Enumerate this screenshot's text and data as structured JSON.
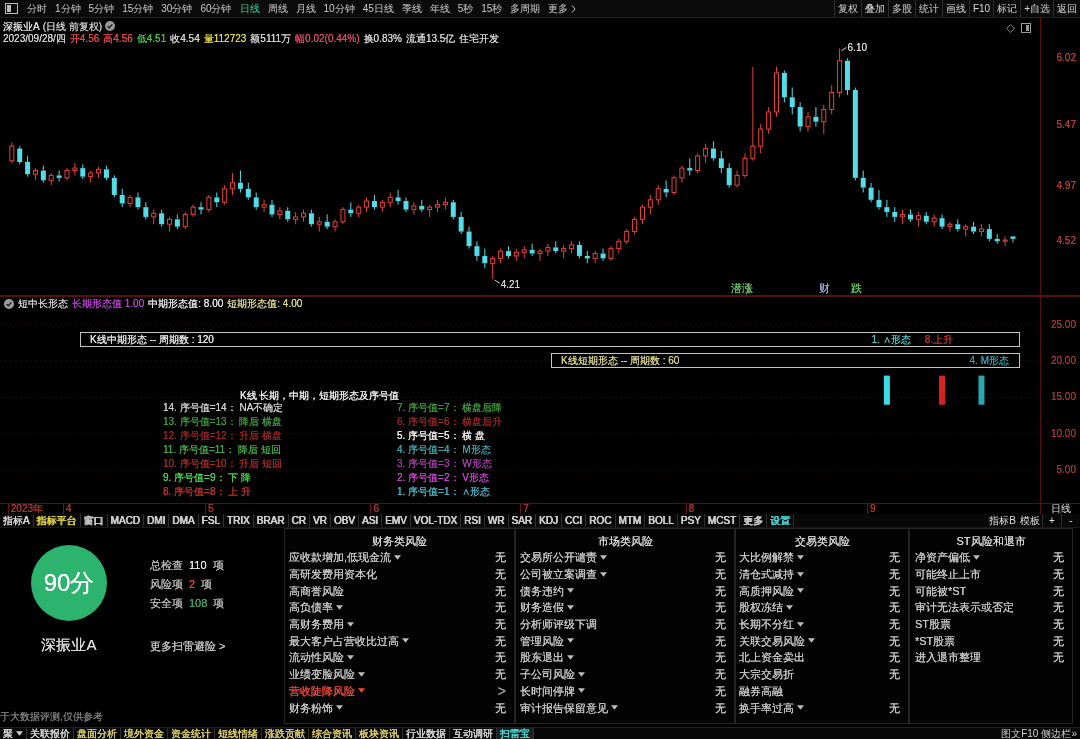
{
  "toolbar": {
    "periods": [
      {
        "label": "分时",
        "selected": false
      },
      {
        "label": "1分钟",
        "selected": false
      },
      {
        "label": "5分钟",
        "selected": false
      },
      {
        "label": "15分钟",
        "selected": false
      },
      {
        "label": "30分钟",
        "selected": false
      },
      {
        "label": "60分钟",
        "selected": false
      },
      {
        "label": "日线",
        "selected": true
      },
      {
        "label": "周线",
        "selected": false
      },
      {
        "label": "月线",
        "selected": false
      },
      {
        "label": "10分钟",
        "selected": false
      },
      {
        "label": "45日线",
        "selected": false
      },
      {
        "label": "季线",
        "selected": false
      },
      {
        "label": "年线",
        "selected": false
      },
      {
        "label": "5秒",
        "selected": false
      },
      {
        "label": "15秒",
        "selected": false
      },
      {
        "label": "多周期",
        "selected": false
      }
    ],
    "more": "更多",
    "actions": [
      "复权",
      "叠加",
      "多股",
      "统计",
      "画线",
      "F10",
      "标记",
      "+自选",
      "返回"
    ]
  },
  "quote": {
    "stock": "深振业A",
    "mode": "(日线 前复权)",
    "date": "2023/09/28/四",
    "fields": [
      {
        "text": "开4.56",
        "color": "#e84848"
      },
      {
        "text": "高4.56",
        "color": "#e84848"
      },
      {
        "text": "低4.51",
        "color": "#3cc83c"
      },
      {
        "text": "收4.54",
        "color": "#d4d4d4"
      },
      {
        "text": "量112723",
        "color": "#e6d64a"
      },
      {
        "text": "额5111万",
        "color": "#d4d4d4"
      },
      {
        "text": "幅0.02(0.44%)",
        "color": "#d84a6a"
      },
      {
        "text": "换0.83%",
        "color": "#d4d4d4"
      },
      {
        "text": "流通13.5亿",
        "color": "#d4d4d4"
      },
      {
        "text": "住宅开发",
        "color": "#d4d4d4"
      }
    ]
  },
  "chart": {
    "chart_data": [
      {
        "type": "candlestick",
        "ylim": [
          4.08,
          6.35
        ],
        "yticks": [
          4.52,
          4.97,
          5.47,
          6.02
        ],
        "annotations": [
          "6.10",
          "4.21",
          "潜涨",
          "财",
          "跌"
        ],
        "ohlc": [
          null,
          [
            5.18,
            5.33,
            5.16,
            5.3
          ],
          [
            5.28,
            5.3,
            5.15,
            5.17
          ],
          [
            5.17,
            5.22,
            5.05,
            5.07
          ],
          [
            5.07,
            5.12,
            5.02,
            5.1
          ],
          [
            5.1,
            5.14,
            5.0,
            5.02
          ],
          [
            5.02,
            5.08,
            4.98,
            5.06
          ],
          [
            5.06,
            5.1,
            5.01,
            5.04
          ],
          [
            5.04,
            5.12,
            5.02,
            5.1
          ],
          [
            5.1,
            5.16,
            5.06,
            5.12
          ],
          [
            5.12,
            5.15,
            5.03,
            5.05
          ],
          [
            5.05,
            5.1,
            5.0,
            5.08
          ],
          [
            5.08,
            5.13,
            5.04,
            5.11
          ],
          [
            5.11,
            5.14,
            5.02,
            5.04
          ],
          [
            5.04,
            5.06,
            4.88,
            4.9
          ],
          [
            4.9,
            4.95,
            4.8,
            4.83
          ],
          [
            4.83,
            4.9,
            4.8,
            4.88
          ],
          [
            4.88,
            4.92,
            4.78,
            4.8
          ],
          [
            4.8,
            4.84,
            4.7,
            4.72
          ],
          [
            4.72,
            4.78,
            4.66,
            4.75
          ],
          [
            4.75,
            4.78,
            4.64,
            4.66
          ],
          [
            4.66,
            4.72,
            4.6,
            4.7
          ],
          [
            4.7,
            4.74,
            4.62,
            4.64
          ],
          [
            4.64,
            4.76,
            4.62,
            4.74
          ],
          [
            4.74,
            4.82,
            4.72,
            4.8
          ],
          [
            4.8,
            4.84,
            4.74,
            4.78
          ],
          [
            4.78,
            4.9,
            4.76,
            4.88
          ],
          [
            4.88,
            4.92,
            4.8,
            4.84
          ],
          [
            4.84,
            4.98,
            4.82,
            4.95
          ],
          [
            4.95,
            5.08,
            4.9,
            5.0
          ],
          [
            5.0,
            5.1,
            4.92,
            4.95
          ],
          [
            4.95,
            5.0,
            4.86,
            4.88
          ],
          [
            4.88,
            4.92,
            4.78,
            4.8
          ],
          [
            4.8,
            4.86,
            4.76,
            4.82
          ],
          [
            4.82,
            4.86,
            4.72,
            4.74
          ],
          [
            4.74,
            4.8,
            4.7,
            4.77
          ],
          [
            4.77,
            4.8,
            4.68,
            4.7
          ],
          [
            4.7,
            4.76,
            4.66,
            4.72
          ],
          [
            4.72,
            4.78,
            4.68,
            4.75
          ],
          [
            4.75,
            4.78,
            4.64,
            4.66
          ],
          [
            4.66,
            4.72,
            4.6,
            4.68
          ],
          [
            4.68,
            4.74,
            4.62,
            4.64
          ],
          [
            4.64,
            4.7,
            4.6,
            4.68
          ],
          [
            4.68,
            4.8,
            4.66,
            4.78
          ],
          [
            4.78,
            4.84,
            4.72,
            4.75
          ],
          [
            4.75,
            4.82,
            4.72,
            4.8
          ],
          [
            4.8,
            4.88,
            4.76,
            4.85
          ],
          [
            4.85,
            4.9,
            4.78,
            4.8
          ],
          [
            4.8,
            4.86,
            4.76,
            4.84
          ],
          [
            4.84,
            4.92,
            4.8,
            4.88
          ],
          [
            4.88,
            4.94,
            4.82,
            4.85
          ],
          [
            4.85,
            4.88,
            4.76,
            4.78
          ],
          [
            4.78,
            4.84,
            4.74,
            4.81
          ],
          [
            4.81,
            4.86,
            4.76,
            4.78
          ],
          [
            4.78,
            4.82,
            4.72,
            4.8
          ],
          [
            4.8,
            4.86,
            4.76,
            4.82
          ],
          [
            4.82,
            4.88,
            4.78,
            4.84
          ],
          [
            4.84,
            4.86,
            4.7,
            4.72
          ],
          [
            4.72,
            4.76,
            4.58,
            4.6
          ],
          [
            4.6,
            4.64,
            4.46,
            4.48
          ],
          [
            4.48,
            4.52,
            4.36,
            4.4
          ],
          [
            4.4,
            4.46,
            4.3,
            4.34
          ],
          [
            4.34,
            4.4,
            4.21,
            4.38
          ],
          [
            4.38,
            4.46,
            4.34,
            4.44
          ],
          [
            4.44,
            4.48,
            4.38,
            4.4
          ],
          [
            4.4,
            4.46,
            4.36,
            4.43
          ],
          [
            4.43,
            4.48,
            4.38,
            4.45
          ],
          [
            4.45,
            4.5,
            4.4,
            4.42
          ],
          [
            4.42,
            4.46,
            4.36,
            4.44
          ],
          [
            4.44,
            4.5,
            4.4,
            4.47
          ],
          [
            4.47,
            4.52,
            4.42,
            4.44
          ],
          [
            4.44,
            4.49,
            4.38,
            4.46
          ],
          [
            4.46,
            4.52,
            4.42,
            4.49
          ],
          [
            4.49,
            4.52,
            4.38,
            4.4
          ],
          [
            4.4,
            4.44,
            4.34,
            4.38
          ],
          [
            4.38,
            4.44,
            4.34,
            4.42
          ],
          [
            4.42,
            4.46,
            4.36,
            4.38
          ],
          [
            4.38,
            4.48,
            4.36,
            4.46
          ],
          [
            4.46,
            4.54,
            4.42,
            4.52
          ],
          [
            4.52,
            4.62,
            4.5,
            4.6
          ],
          [
            4.6,
            4.72,
            4.58,
            4.7
          ],
          [
            4.7,
            4.82,
            4.66,
            4.8
          ],
          [
            4.8,
            4.9,
            4.74,
            4.86
          ],
          [
            4.86,
            4.98,
            4.82,
            4.95
          ],
          [
            4.95,
            5.02,
            4.88,
            4.92
          ],
          [
            4.92,
            5.06,
            4.9,
            5.04
          ],
          [
            5.04,
            5.14,
            5.0,
            5.12
          ],
          [
            5.12,
            5.2,
            5.06,
            5.1
          ],
          [
            5.1,
            5.24,
            5.08,
            5.22
          ],
          [
            5.22,
            5.32,
            5.16,
            5.28
          ],
          [
            5.28,
            5.34,
            5.18,
            5.2
          ],
          [
            5.2,
            5.26,
            5.08,
            5.12
          ],
          [
            5.12,
            5.16,
            4.96,
            4.98
          ],
          [
            4.98,
            5.1,
            4.96,
            5.06
          ],
          [
            5.06,
            5.24,
            5.04,
            5.2
          ],
          [
            5.2,
            5.95,
            5.18,
            5.3
          ],
          [
            5.3,
            5.48,
            5.24,
            5.44
          ],
          [
            5.44,
            5.62,
            5.4,
            5.58
          ],
          [
            5.58,
            5.95,
            5.54,
            5.9
          ],
          [
            5.9,
            5.92,
            5.66,
            5.7
          ],
          [
            5.7,
            5.78,
            5.56,
            5.62
          ],
          [
            5.62,
            5.66,
            5.42,
            5.46
          ],
          [
            5.46,
            5.58,
            5.42,
            5.54
          ],
          [
            5.54,
            5.62,
            5.46,
            5.5
          ],
          [
            5.5,
            5.64,
            5.4,
            5.6
          ],
          [
            5.6,
            5.8,
            5.56,
            5.74
          ],
          [
            5.74,
            6.1,
            5.7,
            6.0
          ],
          [
            6.0,
            6.02,
            5.72,
            5.76
          ],
          [
            5.76,
            5.78,
            5.02,
            5.04
          ],
          [
            5.04,
            5.1,
            4.92,
            4.96
          ],
          [
            4.96,
            5.0,
            4.84,
            4.86
          ],
          [
            4.86,
            4.94,
            4.78,
            4.8
          ],
          [
            4.8,
            4.86,
            4.72,
            4.76
          ],
          [
            4.76,
            4.8,
            4.68,
            4.72
          ],
          [
            4.72,
            4.78,
            4.66,
            4.74
          ],
          [
            4.74,
            4.78,
            4.68,
            4.7
          ],
          [
            4.7,
            4.76,
            4.64,
            4.73
          ],
          [
            4.73,
            4.76,
            4.66,
            4.68
          ],
          [
            4.68,
            4.74,
            4.64,
            4.71
          ],
          [
            4.71,
            4.74,
            4.62,
            4.64
          ],
          [
            4.64,
            4.68,
            4.6,
            4.66
          ],
          [
            4.66,
            4.7,
            4.6,
            4.62
          ],
          [
            4.62,
            4.66,
            4.56,
            4.64
          ],
          [
            4.64,
            4.68,
            4.58,
            4.6
          ],
          [
            4.6,
            4.66,
            4.56,
            4.62
          ],
          [
            4.62,
            4.66,
            4.52,
            4.54
          ],
          [
            4.54,
            4.58,
            4.5,
            4.52
          ],
          [
            4.52,
            4.56,
            4.48,
            4.53
          ],
          [
            4.56,
            4.56,
            4.51,
            4.54
          ],
          null,
          null,
          null,
          null,
          null,
          null,
          null,
          null
        ]
      },
      {
        "type": "bar",
        "ylim": [
          0.5,
          28.8
        ],
        "grid": true,
        "yticks": [
          {
            "value": 5,
            "label": "5.00"
          },
          {
            "value": 10,
            "label": "10.00"
          },
          {
            "value": 15,
            "label": "15.00"
          },
          {
            "value": 20,
            "label": "20.00"
          },
          {
            "value": 25,
            "label": "25.00"
          }
        ],
        "categories": [
          "2023年",
          null,
          null,
          null,
          null,
          null,
          null,
          "4",
          null,
          null,
          null,
          null,
          null,
          null,
          null,
          null,
          null,
          null,
          null,
          null,
          null,
          null,
          null,
          null,
          null,
          "5",
          null,
          null,
          null,
          null,
          null,
          null,
          null,
          null,
          null,
          null,
          null,
          null,
          null,
          null,
          null,
          null,
          null,
          null,
          null,
          null,
          "6",
          null,
          null,
          null,
          null,
          null,
          null,
          null,
          null,
          null,
          null,
          null,
          null,
          null,
          null,
          null,
          null,
          null,
          null,
          "7",
          null,
          null,
          null,
          null,
          null,
          null,
          null,
          null,
          null,
          null,
          null,
          null,
          null,
          null,
          null,
          null,
          null,
          null,
          null,
          null,
          "8",
          null,
          null,
          null,
          null,
          null,
          null,
          null,
          null,
          null,
          null,
          null,
          null,
          null,
          null,
          null,
          null,
          null,
          null,
          null,
          null,
          null,
          null,
          "9",
          null,
          null,
          null,
          null,
          null,
          null,
          null,
          null,
          null,
          null,
          null,
          null,
          null,
          null,
          null,
          null,
          null,
          null
        ],
        "values": [
          null,
          null,
          null,
          null,
          null,
          null,
          null,
          null,
          null,
          null,
          null,
          null,
          null,
          null,
          null,
          null,
          null,
          null,
          null,
          null,
          null,
          null,
          null,
          null,
          null,
          null,
          null,
          null,
          null,
          null,
          null,
          null,
          null,
          null,
          null,
          null,
          null,
          null,
          null,
          null,
          null,
          null,
          null,
          null,
          null,
          null,
          null,
          null,
          null,
          null,
          null,
          null,
          null,
          null,
          null,
          null,
          null,
          null,
          null,
          null,
          null,
          null,
          null,
          null,
          null,
          null,
          null,
          null,
          null,
          null,
          null,
          null,
          null,
          null,
          null,
          null,
          null,
          null,
          null,
          null,
          null,
          null,
          null,
          null,
          null,
          null,
          null,
          null,
          null,
          null,
          null,
          null,
          null,
          null,
          null,
          null,
          null,
          null,
          null,
          null,
          null,
          null,
          null,
          null,
          null,
          null,
          null,
          null,
          null,
          null,
          null,
          4,
          null,
          null,
          null,
          null,
          null,
          null,
          4,
          null,
          null,
          null,
          null,
          4,
          null,
          null,
          null,
          null
        ],
        "base": [
          null,
          null,
          null,
          null,
          null,
          null,
          null,
          null,
          null,
          null,
          null,
          null,
          null,
          null,
          null,
          null,
          null,
          null,
          null,
          null,
          null,
          null,
          null,
          null,
          null,
          null,
          null,
          null,
          null,
          null,
          null,
          null,
          null,
          null,
          null,
          null,
          null,
          null,
          null,
          null,
          null,
          null,
          null,
          null,
          null,
          null,
          null,
          null,
          null,
          null,
          null,
          null,
          null,
          null,
          null,
          null,
          null,
          null,
          null,
          null,
          null,
          null,
          null,
          null,
          null,
          null,
          null,
          null,
          null,
          null,
          null,
          null,
          null,
          null,
          null,
          null,
          null,
          null,
          null,
          null,
          null,
          null,
          null,
          null,
          null,
          null,
          null,
          null,
          null,
          null,
          null,
          null,
          null,
          null,
          null,
          null,
          null,
          null,
          null,
          null,
          null,
          null,
          null,
          null,
          null,
          null,
          null,
          null,
          null,
          null,
          null,
          14,
          null,
          null,
          null,
          null,
          null,
          null,
          14,
          null,
          null,
          null,
          null,
          14,
          null,
          null,
          null,
          null
        ],
        "colors": [
          null,
          null,
          null,
          null,
          null,
          null,
          null,
          null,
          null,
          null,
          null,
          null,
          null,
          null,
          null,
          null,
          null,
          null,
          null,
          null,
          null,
          null,
          null,
          null,
          null,
          null,
          null,
          null,
          null,
          null,
          null,
          null,
          null,
          null,
          null,
          null,
          null,
          null,
          null,
          null,
          null,
          null,
          null,
          null,
          null,
          null,
          null,
          null,
          null,
          null,
          null,
          null,
          null,
          null,
          null,
          null,
          null,
          null,
          null,
          null,
          null,
          null,
          null,
          null,
          null,
          null,
          null,
          null,
          null,
          null,
          null,
          null,
          null,
          null,
          null,
          null,
          null,
          null,
          null,
          null,
          null,
          null,
          null,
          null,
          null,
          null,
          null,
          null,
          null,
          null,
          null,
          null,
          null,
          null,
          null,
          null,
          null,
          null,
          null,
          null,
          null,
          null,
          null,
          null,
          null,
          null,
          null,
          null,
          null,
          null,
          null,
          "#3cdce6",
          null,
          null,
          null,
          null,
          null,
          null,
          "#d82222",
          null,
          null,
          null,
          null,
          "#2aa6ae",
          null,
          null,
          null,
          null
        ]
      }
    ],
    "period_badge": "日线"
  },
  "indicator": {
    "name": "短中长形态",
    "readings": [
      {
        "label": "长期形态值",
        "value": "1.00",
        "color": "#c23fd8"
      },
      {
        "label": "中期形态值:",
        "value": "8.00",
        "color": "#e6e6e6"
      },
      {
        "label": "短期形态值:",
        "value": "4.00",
        "color": "#dcd88a"
      }
    ],
    "boxes": [
      {
        "title": "K线中期形态 -- 周期数 : 120",
        "color": "#e6e6e6",
        "results": [
          {
            "text": "1. ∧形态",
            "color": "#4cc0c8"
          },
          {
            "text": "8.上升",
            "color": "#b83030"
          }
        ]
      },
      {
        "title": "K线短期形态 -- 周期数 : 60",
        "color": "#d8d48c",
        "results": [
          {
            "text": "4. M形态",
            "color": "#3a9ea6"
          }
        ]
      }
    ],
    "legend": {
      "title": "K线 长期，中期，短期形态及序号值",
      "columns": [
        [
          {
            "text": "14. 序号值=14： NA不确定",
            "color": "#cfcfcf"
          },
          {
            "text": "13. 序号值=13： 降后 横盘",
            "color": "#3c9a3c"
          },
          {
            "text": "12. 序号值=12： 升后 横盘",
            "color": "#9c2424"
          },
          {
            "text": "11. 序号值=11： 降后 短回",
            "color": "#44a844"
          },
          {
            "text": "10. 序号值=10： 升后 短回",
            "color": "#a42a2a"
          },
          {
            "text": "9. 序号值=9： 下 降",
            "color": "#46d846"
          },
          {
            "text": "8. 序号值=8： 上 升",
            "color": "#c03030"
          }
        ],
        [
          {
            "text": "7. 序号值=7： 横盘后降",
            "color": "#3c9a3c"
          },
          {
            "text": "6. 序号值=6： 横盘后升",
            "color": "#9c2424"
          },
          {
            "text": "5. 序号值=5： 横 盘",
            "color": "#f2f2f2"
          },
          {
            "text": "4. 序号值=4： M形态",
            "color": "#3ea2a8"
          },
          {
            "text": "3. 序号值=3： W形态",
            "color": "#a23ea8"
          },
          {
            "text": "2. 序号值=2： V形态",
            "color": "#c844cc"
          },
          {
            "text": "1. 序号值=1： ∧形态",
            "color": "#44b4c4"
          }
        ]
      ]
    }
  },
  "indicator_tabs": {
    "tabs": [
      {
        "label": "指标A",
        "color": "#d0d0d0"
      },
      {
        "label": "指标平台",
        "color": "#dcd04a"
      },
      {
        "label": "窗口",
        "color": "#d0d0d0"
      },
      {
        "label": "MACD",
        "color": "#d0d0d0"
      },
      {
        "label": "DMI",
        "color": "#d0d0d0"
      },
      {
        "label": "DMA",
        "color": "#d0d0d0"
      },
      {
        "label": "FSL",
        "color": "#d0d0d0"
      },
      {
        "label": "TRIX",
        "color": "#d0d0d0"
      },
      {
        "label": "BRAR",
        "color": "#d0d0d0"
      },
      {
        "label": "CR",
        "color": "#d0d0d0"
      },
      {
        "label": "VR",
        "color": "#d0d0d0"
      },
      {
        "label": "OBV",
        "color": "#d0d0d0"
      },
      {
        "label": "ASI",
        "color": "#d0d0d0"
      },
      {
        "label": "EMV",
        "color": "#d0d0d0"
      },
      {
        "label": "VOL-TDX",
        "color": "#d0d0d0"
      },
      {
        "label": "RSI",
        "color": "#d0d0d0"
      },
      {
        "label": "WR",
        "color": "#d0d0d0"
      },
      {
        "label": "SAR",
        "color": "#d0d0d0"
      },
      {
        "label": "KDJ",
        "color": "#d0d0d0"
      },
      {
        "label": "CCI",
        "color": "#d0d0d0"
      },
      {
        "label": "ROC",
        "color": "#d0d0d0"
      },
      {
        "label": "MTM",
        "color": "#d0d0d0"
      },
      {
        "label": "BOLL",
        "color": "#d0d0d0"
      },
      {
        "label": "PSY",
        "color": "#d0d0d0"
      },
      {
        "label": "MCST",
        "color": "#d0d0d0"
      },
      {
        "label": "更多",
        "color": "#d0d0d0"
      },
      {
        "label": "设置",
        "color": "#4cd8d8"
      }
    ],
    "right": [
      "指标B",
      "模板",
      "+",
      "-"
    ]
  },
  "risk_scan": {
    "score": "90分",
    "stock": "深振业A",
    "stats": [
      {
        "label": "总检查",
        "value": "110",
        "unit": "项",
        "color": "#e6e6e6"
      },
      {
        "label": "风险项",
        "value": "2",
        "unit": "项",
        "color": "#e0484a"
      },
      {
        "label": "安全项",
        "value": "108",
        "unit": "项",
        "color": "#3aa872"
      }
    ],
    "more_link": "更多扫雷避险 >",
    "disclaimer": "于大数据评测,仅供参考",
    "categories": [
      {
        "title": "财务类风险",
        "items": [
          {
            "label": "应收款增加,低现金流",
            "expandable": true,
            "risk": false,
            "value": "无"
          },
          {
            "label": "高研发费用资本化",
            "expandable": false,
            "risk": false,
            "value": "无"
          },
          {
            "label": "高商誉风险",
            "expandable": false,
            "risk": false,
            "value": "无"
          },
          {
            "label": "高负债率",
            "expandable": true,
            "risk": false,
            "value": "无"
          },
          {
            "label": "高财务费用",
            "expandable": true,
            "risk": false,
            "value": "无"
          },
          {
            "label": "最大客户占营收比过高",
            "expandable": true,
            "risk": false,
            "value": "无"
          },
          {
            "label": "流动性风险",
            "expandable": true,
            "risk": false,
            "value": "无"
          },
          {
            "label": "业绩变脸风险",
            "expandable": true,
            "risk": false,
            "value": "无"
          },
          {
            "label": "营收陡降风险",
            "expandable": true,
            "risk": true,
            "value": ">"
          },
          {
            "label": "财务粉饰",
            "expandable": true,
            "risk": false,
            "value": "无"
          }
        ]
      },
      {
        "title": "市场类风险",
        "items": [
          {
            "label": "交易所公开谴责",
            "expandable": true,
            "risk": false,
            "value": "无"
          },
          {
            "label": "公司被立案调查",
            "expandable": true,
            "risk": false,
            "value": "无"
          },
          {
            "label": "债务违约",
            "expandable": true,
            "risk": false,
            "value": "无"
          },
          {
            "label": "财务造假",
            "expandable": true,
            "risk": false,
            "value": "无"
          },
          {
            "label": "分析师评级下调",
            "expandable": false,
            "risk": false,
            "value": "无"
          },
          {
            "label": "管理风险",
            "expandable": true,
            "risk": false,
            "value": "无"
          },
          {
            "label": "股东退出",
            "expandable": true,
            "risk": false,
            "value": "无"
          },
          {
            "label": "子公司风险",
            "expandable": true,
            "risk": false,
            "value": "无"
          },
          {
            "label": "长时间停牌",
            "expandable": true,
            "risk": false,
            "value": "无"
          },
          {
            "label": "审计报告保留意见",
            "expandable": true,
            "risk": false,
            "value": "无"
          }
        ]
      },
      {
        "title": "交易类风险",
        "items": [
          {
            "label": "大比例解禁",
            "expandable": true,
            "risk": false,
            "value": "无"
          },
          {
            "label": "清仓式减持",
            "expandable": true,
            "risk": false,
            "value": "无"
          },
          {
            "label": "高质押风险",
            "expandable": true,
            "risk": false,
            "value": "无"
          },
          {
            "label": "股权冻结",
            "expandable": true,
            "risk": false,
            "value": "无"
          },
          {
            "label": "长期不分红",
            "expandable": true,
            "risk": false,
            "value": "无"
          },
          {
            "label": "关联交易风险",
            "expandable": true,
            "risk": false,
            "value": "无"
          },
          {
            "label": "北上资金卖出",
            "expandable": false,
            "risk": false,
            "value": "无"
          },
          {
            "label": "大宗交易折",
            "expandable": false,
            "risk": false,
            "value": "无"
          },
          {
            "label": "融券高融",
            "expandable": false,
            "risk": false
          },
          {
            "label": "换手率过高",
            "expandable": true,
            "risk": false,
            "value": "无"
          }
        ]
      },
      {
        "title": "ST风险和退市",
        "items": [
          {
            "label": "净资产偏低",
            "expandable": true,
            "risk": false,
            "value": "无"
          },
          {
            "label": "可能终止上市",
            "expandable": false,
            "risk": false,
            "value": "无"
          },
          {
            "label": "可能被*ST",
            "expandable": false,
            "risk": false,
            "value": "无"
          },
          {
            "label": "审计无法表示或否定",
            "expandable": false,
            "risk": false,
            "value": "无"
          },
          {
            "label": "ST股票",
            "expandable": false,
            "risk": false,
            "value": "无"
          },
          {
            "label": "*ST股票",
            "expandable": false,
            "risk": false,
            "value": "无"
          },
          {
            "label": "进入退市整理",
            "expandable": false,
            "risk": false,
            "value": "无"
          }
        ]
      }
    ]
  },
  "bottom_tabs": {
    "tabs": [
      {
        "label": "聚",
        "dropdown": true,
        "selected": false,
        "color": "#d0d0d0"
      },
      {
        "label": "关联报价",
        "dropdown": false,
        "selected": false,
        "color": "#d0d0d0"
      },
      {
        "label": "盘面分析",
        "dropdown": false,
        "selected": false,
        "color": "#d8c862"
      },
      {
        "label": "境外资金",
        "dropdown": false,
        "selected": false,
        "color": "#d8c862"
      },
      {
        "label": "资金统计",
        "dropdown": false,
        "selected": false,
        "color": "#d8c862"
      },
      {
        "label": "短线情绪",
        "dropdown": false,
        "selected": false,
        "color": "#d8c862"
      },
      {
        "label": "涨跌贡献",
        "dropdown": false,
        "selected": false,
        "color": "#d8c862"
      },
      {
        "label": "综合资讯",
        "dropdown": false,
        "selected": false,
        "color": "#d8c862"
      },
      {
        "label": "板块资讯",
        "dropdown": false,
        "selected": false,
        "color": "#d8c862"
      },
      {
        "label": "行业数据",
        "dropdown": false,
        "selected": false,
        "color": "#d0d0d0"
      },
      {
        "label": "互动调研",
        "dropdown": false,
        "selected": false,
        "color": "#d0d0d0"
      },
      {
        "label": "扫雷宝",
        "dropdown": false,
        "selected": true,
        "color": "#4cd8d8"
      }
    ],
    "side_links": [
      "图文F10",
      "侧边栏»"
    ]
  }
}
